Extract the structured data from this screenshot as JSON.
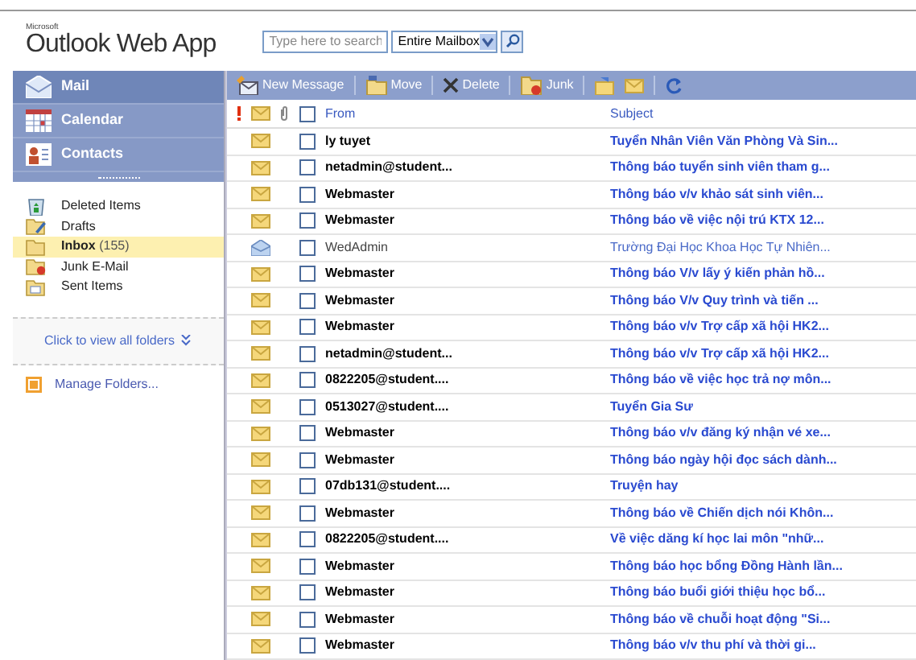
{
  "brand": {
    "small": "Microsoft",
    "title": "Outlook Web App"
  },
  "search": {
    "placeholder": "Type here to search",
    "scope": "Entire Mailbox"
  },
  "nav": [
    {
      "label": "Mail",
      "kind": "mail",
      "selected": true
    },
    {
      "label": "Calendar",
      "kind": "calendar",
      "selected": false
    },
    {
      "label": "Contacts",
      "kind": "contacts",
      "selected": false
    }
  ],
  "folders": [
    {
      "label": "Deleted Items",
      "kind": "trash",
      "selected": false
    },
    {
      "label": "Drafts",
      "kind": "drafts",
      "selected": false
    },
    {
      "label": "Inbox",
      "kind": "inbox",
      "count": "(155)",
      "selected": true
    },
    {
      "label": "Junk E-Mail",
      "kind": "junk",
      "selected": false
    },
    {
      "label": "Sent Items",
      "kind": "sent",
      "selected": false
    }
  ],
  "view_all": "Click to view all folders",
  "manage": "Manage Folders...",
  "toolbar": [
    {
      "label": "New Message",
      "kind": "new"
    },
    {
      "label": "Move",
      "kind": "move"
    },
    {
      "label": "Delete",
      "kind": "delete"
    },
    {
      "label": "Junk",
      "kind": "junk"
    }
  ],
  "columns": {
    "from": "From",
    "subject": "Subject",
    "all_checked": false
  },
  "rows": [
    {
      "from": "ly tuyet",
      "subject": "Tuyển Nhân Viên Văn Phòng Và Sin...",
      "read": false
    },
    {
      "from": "netadmin@student...",
      "subject": "Thông báo tuyển sinh viên tham g...",
      "read": false
    },
    {
      "from": "Webmaster",
      "subject": "Thông báo v/v khảo sát sinh viên...",
      "read": false
    },
    {
      "from": "Webmaster",
      "subject": "Thông báo về việc nội trú KTX 12...",
      "read": false
    },
    {
      "from": "WedAdmin",
      "subject": "Trường Đại Học Khoa Học Tự Nhiên...",
      "read": true
    },
    {
      "from": "Webmaster",
      "subject": "Thông báo V/v lấy ý kiến phản hồ...",
      "read": false
    },
    {
      "from": "Webmaster",
      "subject": "Thông báo V/v Quy trình và tiến ...",
      "read": false
    },
    {
      "from": "Webmaster",
      "subject": "Thông báo v/v Trợ cấp xã hội HK2...",
      "read": false
    },
    {
      "from": "netadmin@student...",
      "subject": "Thông báo v/v Trợ cấp xã hội HK2...",
      "read": false
    },
    {
      "from": "0822205@student....",
      "subject": "Thông báo về việc học trả nợ môn...",
      "read": false
    },
    {
      "from": "0513027@student....",
      "subject": "Tuyển Gia Sư",
      "read": false
    },
    {
      "from": "Webmaster",
      "subject": "Thông báo v/v đăng ký nhận vé xe...",
      "read": false
    },
    {
      "from": "Webmaster",
      "subject": "Thông báo ngày hội đọc sách dành...",
      "read": false
    },
    {
      "from": "07db131@student....",
      "subject": "Truyện hay",
      "read": false
    },
    {
      "from": "Webmaster",
      "subject": "Thông báo về Chiến dịch nói Khôn...",
      "read": false
    },
    {
      "from": "0822205@student....",
      "subject": "Về việc dăng kí học lai môn \"nhữ...",
      "read": false
    },
    {
      "from": "Webmaster",
      "subject": "Thông báo học bổng Đồng Hành lần...",
      "read": false
    },
    {
      "from": "Webmaster",
      "subject": "Thông báo buổi giới thiệu học bổ...",
      "read": false
    },
    {
      "from": "Webmaster",
      "subject": "Thông báo về chuỗi hoạt động \"Si...",
      "read": false
    },
    {
      "from": "Webmaster",
      "subject": "Thông báo v/v thu phí và thời gi...",
      "read": false
    }
  ]
}
